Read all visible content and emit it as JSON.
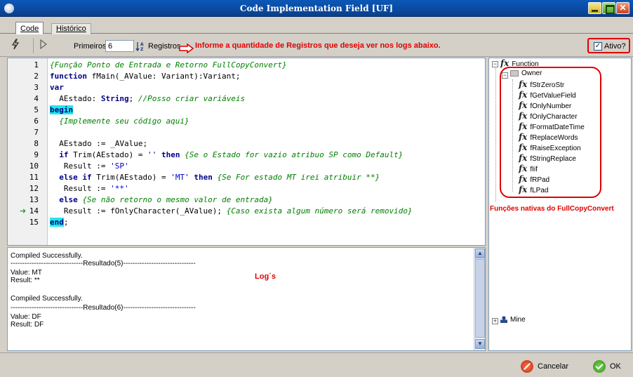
{
  "window": {
    "title": "Code Implementation Field [UF]",
    "close_glyph": "✕"
  },
  "tabs": [
    {
      "label": "Code"
    },
    {
      "label": "Histórico"
    }
  ],
  "toolbar": {
    "primeiros_label": "Primeiros:",
    "primeiros_value": "6",
    "registros_label": "Registros",
    "info_text": "Informe a quantidade de Registros que deseja ver nos logs abaixo.",
    "ativo_label": "Ativo?",
    "ativo_checked": true
  },
  "editor": {
    "lines": [
      {
        "n": "1",
        "code": "{Função Ponto de Entrada e Retorno FullCopyConvert}"
      },
      {
        "n": "2",
        "code": "function fMain(_AValue: Variant):Variant;"
      },
      {
        "n": "3",
        "code": "var"
      },
      {
        "n": "4",
        "code": "  AEstado: String; //Posso criar variáveis"
      },
      {
        "n": "5",
        "code": "begin"
      },
      {
        "n": "6",
        "code": "  {Implemente seu código aqui}"
      },
      {
        "n": "7",
        "code": ""
      },
      {
        "n": "8",
        "code": "  AEstado := _AValue;"
      },
      {
        "n": "9",
        "code": "  if Trim(AEstado) = '' then {Se o Estado for vazio atribuo SP como Default}"
      },
      {
        "n": "10",
        "code": "   Result := 'SP'"
      },
      {
        "n": "11",
        "code": "  else if Trim(AEstado) = 'MT' then {Se For estado MT irei atribuir **}"
      },
      {
        "n": "12",
        "code": "   Result := '**'"
      },
      {
        "n": "13",
        "code": "  else {Se não retorno o mesmo valor de entrada}"
      },
      {
        "n": "14",
        "code": "   Result := fOnlyCharacter(_AValue); {Caso exista algum número será removido}"
      },
      {
        "n": "15",
        "code": "end;"
      }
    ],
    "segments": {
      "l1_c": "{Função Ponto de Entrada e Retorno FullCopyConvert}",
      "l2_k": "function",
      "l2_t": " fMain(_AValue: Variant):Variant;",
      "l3_k": "var",
      "l4_t": "  AEstado: ",
      "l4_k": "String",
      "l4_t2": "; ",
      "l4_c": "//Posso criar variáveis",
      "l5_k": "begin",
      "l6_c": "  {Implemente seu código aqui}",
      "l8_t": "  AEstado := _AValue;",
      "l9_k1": "  if",
      "l9_t": " Trim(AEstado) = ",
      "l9_s": "''",
      "l9_k2": " then",
      "l9_c": " {Se o Estado for vazio atribuo SP como Default}",
      "l10_t": "   Result := ",
      "l10_s": "'SP'",
      "l11_k1": "  else if",
      "l11_t": " Trim(AEstado) = ",
      "l11_s": "'MT'",
      "l11_k2": " then",
      "l11_c": " {Se For estado MT irei atribuir **}",
      "l12_t": "   Result := ",
      "l12_s": "'**'",
      "l13_k": "  else",
      "l13_c": " {Se não retorno o mesmo valor de entrada}",
      "l14_t": "   Result := fOnlyCharacter(_AValue); ",
      "l14_c": "{Caso exista algum número será removido}",
      "l15_k": "end",
      "l15_t": ";"
    }
  },
  "logs": {
    "lines": [
      "Compiled Successfully.",
      "-------------------------------Resultado(5)-------------------------------",
      "Value: MT",
      "Result: **",
      "",
      "Compiled Successfully.",
      "-------------------------------Resultado(6)-------------------------------",
      "Value: DF",
      "Result: DF"
    ],
    "annotation": "Log´s"
  },
  "tree": {
    "root": "Function",
    "owner": "Owner",
    "functions": [
      "fStrZeroStr",
      "fGetValueField",
      "fOnlyNumber",
      "fOnlyCharacter",
      "fFormatDateTime",
      "fReplaceWords",
      "fRaiseException",
      "fStringReplace",
      "fIif",
      "fRPad",
      "fLPad"
    ],
    "mine": "Mine",
    "annotation": "Funções nativas do FullCopyConvert",
    "fx_glyph": "fx"
  },
  "footer": {
    "cancel_label": "Cancelar",
    "ok_label": "OK"
  },
  "colors": {
    "annotation_red": "#e00000",
    "highlight_cyan": "#22e8e8",
    "title_blue": "#0a4aa0"
  }
}
